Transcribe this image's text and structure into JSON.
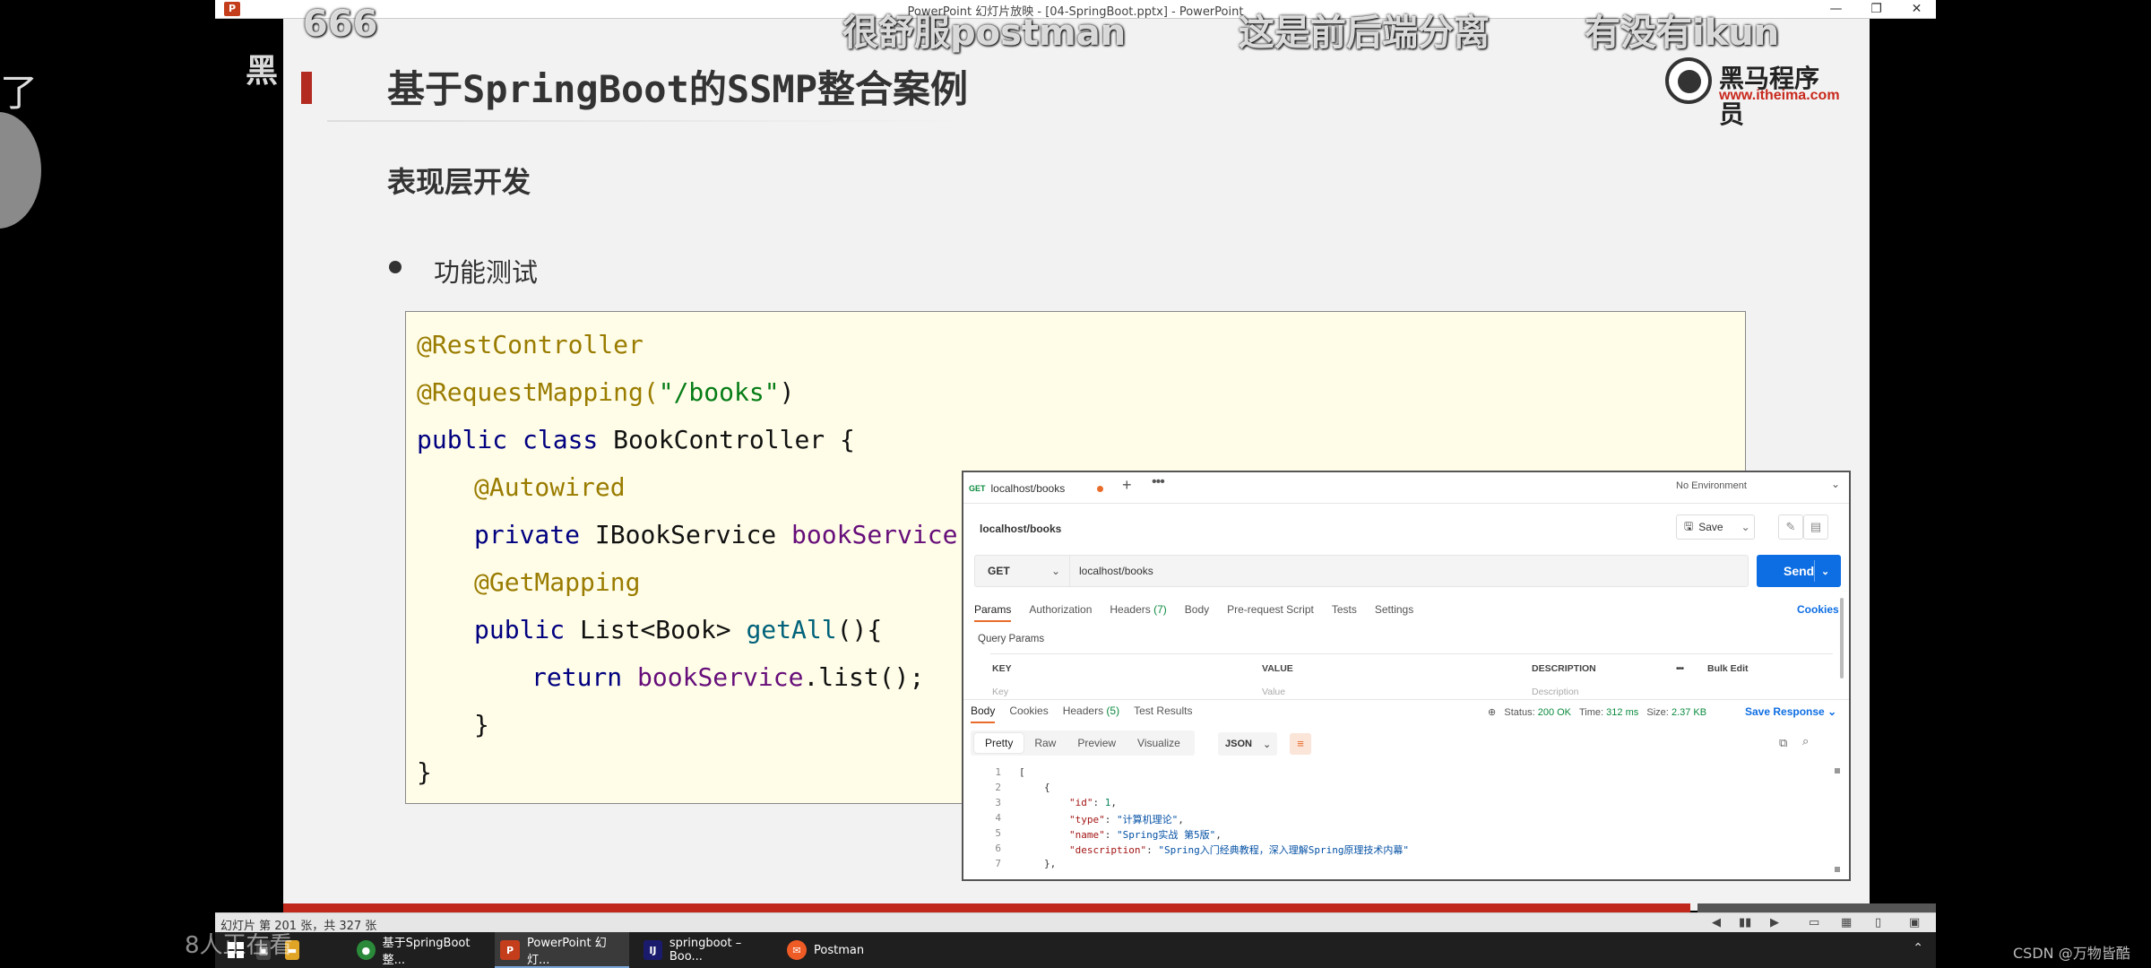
{
  "window": {
    "title": "PowerPoint 幻灯片放映 - [04-SpringBoot.pptx] - PowerPoint",
    "app_icon": "P",
    "minimize": "—",
    "restore": "❐",
    "close": "✕"
  },
  "danmaku": [
    "666",
    "很舒服postman",
    "这是前后端分离",
    "有没有ikun",
    "黑"
  ],
  "left_stub": "了",
  "slide": {
    "title": "基于SpringBoot的SSMP整合案例",
    "logo_name": "黑马程序员",
    "logo_url": "www.itheima.com",
    "subtitle": "表现层开发",
    "bullet": "功能测试",
    "code": {
      "l1": "@RestController",
      "l2a": "@RequestMapping(",
      "l2b": "\"/books\"",
      "l2c": ")",
      "l3a": "public class",
      "l3b": " BookController {",
      "l4": "@Autowired",
      "l5a": "private",
      "l5b": " IBookService ",
      "l5c": "bookService",
      "l5d": ";",
      "l6": "@GetMapping",
      "l7a": "public",
      "l7b": " List<Book> ",
      "l7c": "getAll",
      "l7d": "(){",
      "l8a": "return",
      "l8b": " ",
      "l8c": "bookService",
      "l8d": ".list();",
      "l9": "}",
      "l10": "}"
    }
  },
  "postman": {
    "tab_method": "GET",
    "tab_name": "localhost/books",
    "plus": "+",
    "more": "•••",
    "environment": "No Environment",
    "request_name": "localhost/books",
    "save": "Save",
    "method": "GET",
    "url": "localhost/books",
    "send": "Send",
    "req_tabs": {
      "params": "Params",
      "authorization": "Authorization",
      "headers": "Headers",
      "headers_count": "(7)",
      "body": "Body",
      "prerequest": "Pre-request Script",
      "tests": "Tests",
      "settings": "Settings"
    },
    "cookies": "Cookies",
    "query_params": "Query Params",
    "table": {
      "key": "KEY",
      "value": "VALUE",
      "description": "DESCRIPTION",
      "bulk_edit": "Bulk Edit",
      "more": "•••",
      "ph_key": "Key",
      "ph_value": "Value",
      "ph_desc": "Description"
    },
    "resp_tabs": {
      "body": "Body",
      "cookies": "Cookies",
      "headers": "Headers",
      "headers_count": "(5)",
      "test_results": "Test Results"
    },
    "status_label": "Status:",
    "status": "200 OK",
    "time_label": "Time:",
    "time": "312 ms",
    "size_label": "Size:",
    "size": "2.37 KB",
    "save_response": "Save Response",
    "view_tabs": {
      "pretty": "Pretty",
      "raw": "Raw",
      "preview": "Preview",
      "visualize": "Visualize"
    },
    "format": "JSON",
    "response": {
      "n1": "1",
      "n2": "2",
      "n3": "3",
      "n4": "4",
      "n5": "5",
      "n6": "6",
      "n7": "7",
      "c1": "[",
      "c2": "{",
      "c3k": "\"id\"",
      "c3v": "1",
      "c4k": "\"type\"",
      "c4v": "\"计算机理论\"",
      "c5k": "\"name\"",
      "c5v": "\"Spring实战 第5版\"",
      "c6k": "\"description\"",
      "c6v": "\"Spring入门经典教程，深入理解Spring原理技术内幕\"",
      "c7": "},"
    }
  },
  "status_bar": {
    "text": "幻灯片 第 201 张，共 327 张"
  },
  "taskbar": {
    "items": [
      {
        "label": "基于SpringBoot整...",
        "icon": "chrome-icon"
      },
      {
        "label": "PowerPoint 幻灯...",
        "icon": "powerpoint-icon"
      },
      {
        "label": "springboot – Boo...",
        "icon": "intellij-icon"
      },
      {
        "label": "Postman",
        "icon": "postman-icon"
      }
    ],
    "overlay": "8人正在看"
  },
  "watermark": "CSDN @万物皆酷"
}
